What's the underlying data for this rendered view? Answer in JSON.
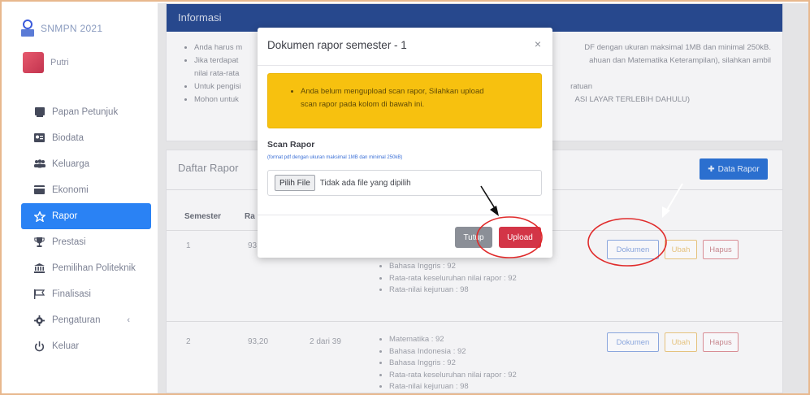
{
  "brand": {
    "name": "SNMPN 2021"
  },
  "user": {
    "name": "Putri"
  },
  "sidebar": {
    "items": [
      {
        "label": "Papan Petunjuk",
        "icon": "dashboard-icon"
      },
      {
        "label": "Biodata",
        "icon": "id-card-icon"
      },
      {
        "label": "Keluarga",
        "icon": "users-icon"
      },
      {
        "label": "Ekonomi",
        "icon": "money-icon"
      },
      {
        "label": "Rapor",
        "icon": "star-icon"
      },
      {
        "label": "Prestasi",
        "icon": "trophy-icon"
      },
      {
        "label": "Pemilihan Politeknik",
        "icon": "institution-icon"
      },
      {
        "label": "Finalisasi",
        "icon": "flag-icon"
      },
      {
        "label": "Pengaturan",
        "icon": "gear-icon"
      },
      {
        "label": "Keluar",
        "icon": "power-icon"
      }
    ],
    "active_index": 4,
    "caret": "‹"
  },
  "info": {
    "title": "Informasi",
    "lines": [
      {
        "left": "Anda harus m",
        "right": "DF dengan ukuran maksimal 1MB dan minimal 250kB."
      },
      {
        "left": "Jika terdapat",
        "right": "ahuan dan Matematika Keterampilan), silahkan ambil"
      },
      {
        "left": "nilai rata-rata",
        "right": ""
      },
      {
        "left": "Untuk pengisi",
        "right": "ratuan"
      },
      {
        "left": "Mohon untuk",
        "right": "ASI LAYAR TERLEBIH DAHULU)"
      }
    ]
  },
  "rapor": {
    "title": "Daftar Rapor",
    "add_button": "Data Rapor",
    "headers": {
      "semester": "Semester",
      "ra": "Ra"
    },
    "rows": [
      {
        "semester": "1",
        "ra": "93",
        "bullets": [
          "Bahasa Inggris : 92",
          "Rata-rata keseluruhan nilai rapor : 92",
          "Rata-nilai kejuruan : 98"
        ],
        "actions": [
          "Dokumen",
          "Ubah",
          "Hapus"
        ]
      },
      {
        "semester": "2",
        "ra": "93,20",
        "rank": "2 dari 39",
        "bullets": [
          "Matematika : 92",
          "Bahasa Indonesia : 92",
          "Bahasa Inggris : 92",
          "Rata-rata keseluruhan nilai rapor : 92",
          "Rata-nilai kejuruan : 98"
        ],
        "actions": [
          "Dokumen",
          "Ubah",
          "Hapus"
        ]
      }
    ]
  },
  "modal": {
    "title": "Dokumen rapor semester - 1",
    "close": "×",
    "alert_line1": "Anda belum mengupload scan rapor, Silahkan upload",
    "alert_line2": "scan rapor pada kolom di bawah ini.",
    "label": "Scan Rapor",
    "note": "(format pdf dengan ukuran maksimal 1MB dan minimal 250kB)",
    "file_button": "Pilih File",
    "file_status": "Tidak ada file yang dipilih",
    "cancel": "Tutup",
    "submit": "Upload"
  },
  "colors": {
    "primary": "#2a82f4",
    "header_blue": "#27488d",
    "alert_yellow": "#f7c10f",
    "danger": "#d33547",
    "annotation_red": "#e02b2b"
  }
}
